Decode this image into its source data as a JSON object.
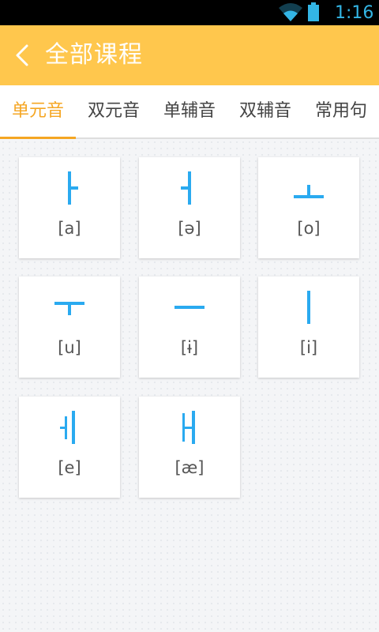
{
  "status_bar": {
    "time": "1:16",
    "icons": [
      "wifi-icon",
      "battery-icon"
    ],
    "color": "#33b5e5"
  },
  "header": {
    "title": "全部课程",
    "back_icon": "chevron-left-icon",
    "background": "#ffc74d"
  },
  "tabs": [
    {
      "label": "单元音",
      "active": true
    },
    {
      "label": "双元音",
      "active": false
    },
    {
      "label": "单辅音",
      "active": false
    },
    {
      "label": "双辅音",
      "active": false
    },
    {
      "label": "常用句",
      "active": false
    }
  ],
  "accent_color": "#f5a623",
  "glyph_color": "#2aaaf0",
  "vowels": [
    {
      "letter": "ㅏ",
      "ipa": "[a]"
    },
    {
      "letter": "ㅓ",
      "ipa": "[ə]"
    },
    {
      "letter": "ㅗ",
      "ipa": "[o]"
    },
    {
      "letter": "ㅜ",
      "ipa": "[u]"
    },
    {
      "letter": "ㅡ",
      "ipa": "[ɨ]"
    },
    {
      "letter": "ㅣ",
      "ipa": "[i]"
    },
    {
      "letter": "ㅔ",
      "ipa": "[e]"
    },
    {
      "letter": "ㅐ",
      "ipa": "[æ]"
    }
  ]
}
